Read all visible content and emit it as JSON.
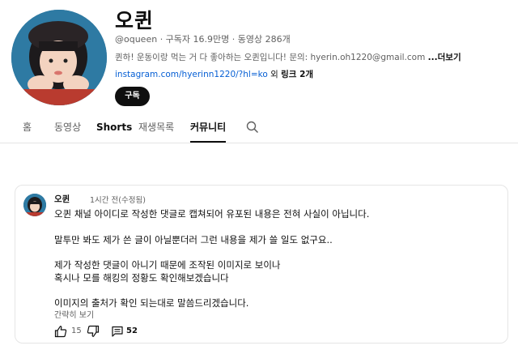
{
  "channel": {
    "name": "오퀸",
    "meta": "@oqueen · 구독자 16.9만명 · 동영상 286개",
    "description": "퀸하! 운동이랑 먹는 거 다 좋아하는 오퀸입니다! 문의: hyerin.oh1220@gmail.com",
    "more_label": "...더보기",
    "link_url": "instagram.com/hyerinn1220/?hl=ko",
    "link_suffix_prefix": " 외 ",
    "link_suffix_bold": "링크 2개",
    "subscribe_label": "구독"
  },
  "tabs": [
    {
      "label": "홈"
    },
    {
      "label": "동영상"
    },
    {
      "label": "Shorts"
    },
    {
      "label": "재생목록"
    },
    {
      "label": "커뮤니티"
    }
  ],
  "post": {
    "author": "오퀸",
    "time": "1시간 전(수정됨)",
    "lines": [
      "오퀸 채널 아이디로 작성한 댓글로 캡쳐되어 유포된 내용은 전혀 사실이 아닙니다.",
      "말투만 봐도 제가 쓴 글이 아닐뿐더러 그런 내용을 제가 쓸 일도 없구요..",
      "제가 작성한 댓글이 아니기 때문에  조작된 이미지로 보이나",
      "혹시나 모를 해킹의 정황도 확인해보겠습니다",
      "이미지의 출처가 확인 되는대로 말씀드리겠습니다."
    ],
    "collapse_label": "간략히 보기",
    "likes": "15",
    "comments": "52"
  },
  "icons": {
    "tab_search": "search-icon",
    "like": "thumb-up-icon",
    "dislike": "thumb-down-icon",
    "comments": "comment-icon"
  }
}
